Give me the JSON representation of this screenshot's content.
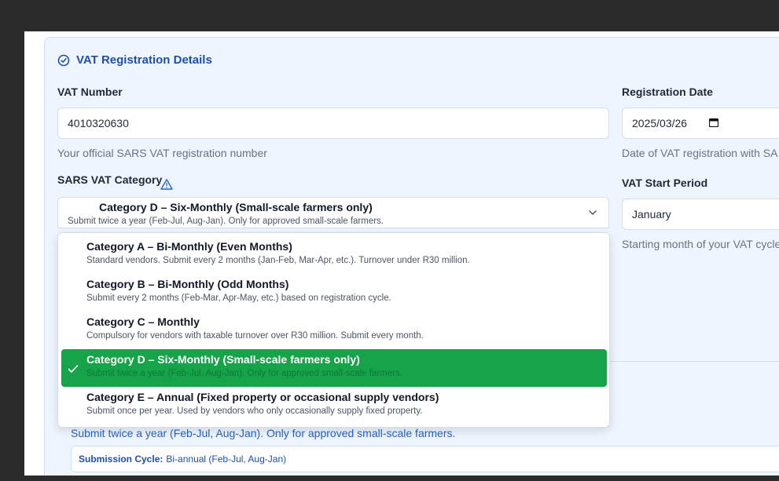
{
  "section": {
    "title": "VAT Registration Details",
    "icon": "check-circle-icon"
  },
  "vat_number": {
    "label": "VAT Number",
    "value": "4010320630",
    "help": "Your official SARS VAT registration number"
  },
  "registration_date": {
    "label": "Registration Date",
    "value": "2025/03/26",
    "help": "Date of VAT registration with SA"
  },
  "vat_category": {
    "label": "SARS VAT Category",
    "selected_title": "Category D – Six-Monthly (Small-scale farmers only)",
    "selected_desc": "Submit twice a year (Feb-Jul, Aug-Jan). Only for approved small-scale farmers.",
    "options": [
      {
        "title": "Category A – Bi-Monthly (Even Months)",
        "desc": "Standard vendors. Submit every 2 months (Jan-Feb, Mar-Apr, etc.). Turnover under R30 million."
      },
      {
        "title": "Category B – Bi-Monthly (Odd Months)",
        "desc": "Submit every 2 months (Feb-Mar, Apr-May, etc.) based on registration cycle."
      },
      {
        "title": "Category C – Monthly",
        "desc": "Compulsory for vendors with taxable turnover over R30 million. Submit every month."
      },
      {
        "title": "Category D – Six-Monthly (Small-scale farmers only)",
        "desc": "Submit twice a year (Feb-Jul, Aug-Jan). Only for approved small-scale farmers."
      },
      {
        "title": "Category E – Annual (Fixed property or occasional supply vendors)",
        "desc": "Submit once per year. Used by vendors who only occasionally supply fixed property."
      }
    ]
  },
  "vat_start": {
    "label": "VAT Start Period",
    "value": "January",
    "help": "Starting month of your VAT cycle"
  },
  "category_info": {
    "description": "Submit twice a year (Feb-Jul, Aug-Jan). Only for approved small-scale farmers.",
    "cycle_label": "Submission Cycle:",
    "cycle_value": "Bi-annual (Feb-Jul, Aug-Jan)"
  },
  "colors": {
    "accent": "#1f4fa6",
    "selected": "#16a34a",
    "panel_bg": "#eef5fe"
  }
}
